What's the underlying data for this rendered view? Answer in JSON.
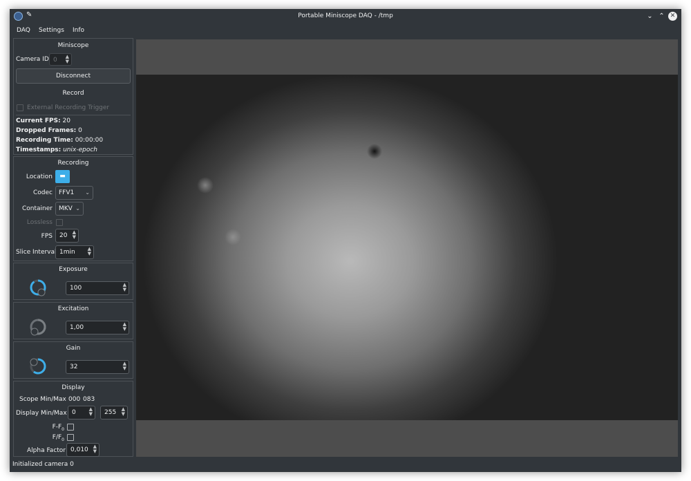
{
  "window": {
    "title": "Portable Miniscope DAQ - /tmp",
    "pin_icon": "pin-icon",
    "buttons": [
      "minimize",
      "maximize",
      "close"
    ]
  },
  "menubar": {
    "items": [
      "DAQ",
      "Settings",
      "Info"
    ]
  },
  "miniscope": {
    "title": "Miniscope",
    "camera_id_label": "Camera ID",
    "camera_id_value": "0",
    "disconnect_label": "Disconnect",
    "record_title": "Record",
    "external_trigger_label": "External Recording Trigger",
    "stats": [
      {
        "label": "Current FPS:",
        "value": "20"
      },
      {
        "label": "Dropped Frames:",
        "value": "0"
      },
      {
        "label": "Recording Time:",
        "value": "00:00:00"
      },
      {
        "label": "Timestamps:",
        "value": "unix-epoch"
      }
    ]
  },
  "recording": {
    "title": "Recording",
    "location_label": "Location",
    "codec_label": "Codec",
    "codec_value": "FFV1",
    "container_label": "Container",
    "container_value": "MKV",
    "lossless_label": "Lossless",
    "fps_label": "FPS",
    "fps_value": "20",
    "slice_label": "Slice Interval",
    "slice_value": "1min"
  },
  "exposure": {
    "title": "Exposure",
    "value": "100",
    "dial_level": 0.9
  },
  "excitation": {
    "title": "Excitation",
    "value": "1,00",
    "dial_level": 0.55
  },
  "gain": {
    "title": "Gain",
    "value": "32",
    "dial_level": 0.6
  },
  "display": {
    "title": "Display",
    "scope_minmax_label": "Scope Min/Max",
    "scope_min": "000",
    "scope_max": "083",
    "display_minmax_label": "Display Min/Max",
    "display_min": "0",
    "display_max": "255",
    "ff0_label": "F-F",
    "ff0_sub": "0",
    "fdivf0_label": "F/F",
    "fdivf0_sub": "0",
    "alpha_label": "Alpha Factor",
    "alpha_value": "0,010"
  },
  "status": {
    "text": "Initialized camera 0"
  },
  "colors": {
    "accent": "#3daee9",
    "background": "#31363b",
    "text": "#eff0f1"
  }
}
